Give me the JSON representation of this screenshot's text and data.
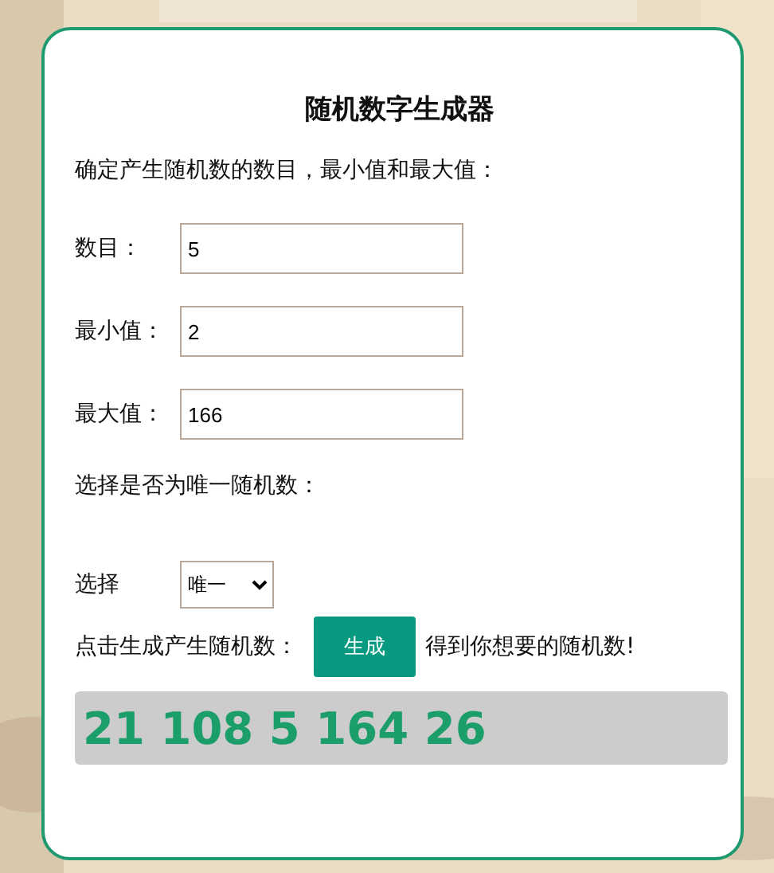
{
  "title": "随机数字生成器",
  "intro": "确定产生随机数的数目，最小值和最大值：",
  "fields": [
    {
      "label": "数目：",
      "value": "5"
    },
    {
      "label": "最小值：",
      "value": "2"
    },
    {
      "label": "最大值：",
      "value": "166"
    }
  ],
  "unique_prompt": "选择是否为唯一随机数：",
  "choice": {
    "label": "选择",
    "value": "唯一"
  },
  "generate": {
    "before": "点击生成产生随机数：",
    "button": "生成",
    "after": "得到你想要的随机数!"
  },
  "result": "21 108 5 164 26"
}
